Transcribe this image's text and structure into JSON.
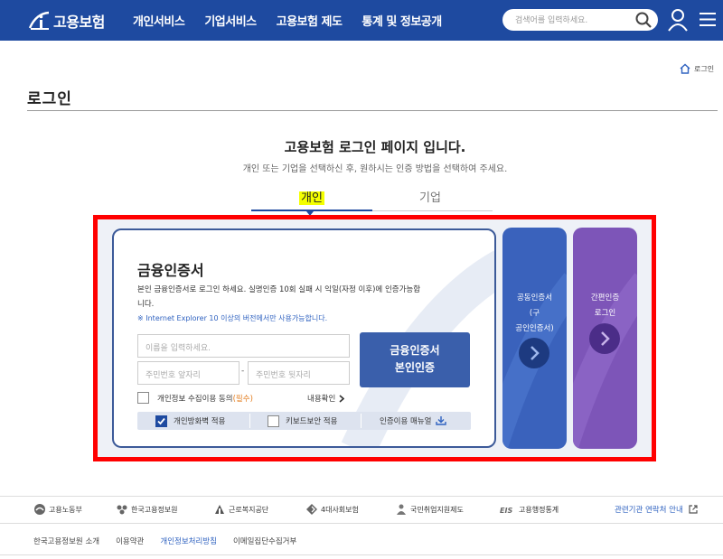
{
  "header": {
    "logo_text": "고용보험",
    "nav": [
      "개인서비스",
      "기업서비스",
      "고용보험 제도",
      "통계 및 정보공개"
    ],
    "search_placeholder": "검색어를 입력하세요.",
    "icons": {
      "search": "search-icon",
      "user": "user-icon",
      "menu": "hamburger-menu-icon"
    },
    "color": "#1e4aa0"
  },
  "breadcrumb": {
    "home_label": "로그인"
  },
  "page": {
    "title": "로그인",
    "heading": "고용보험 로그인 페이지 입니다.",
    "subheading": "개인 또는 기업을 선택하신 후, 원하시는 인증 방법을 선택하여 주세요."
  },
  "tabs": [
    {
      "label": "개인",
      "active": true
    },
    {
      "label": "기업",
      "active": false
    }
  ],
  "financial_cert": {
    "title": "금융인증서",
    "desc": "본인 금융인증서로 로그인 하세요. 실명인증 10회 실패 시 익일(자정 이후)에 인증가능합니다.",
    "note": "※ Internet Explorer 10 이상의 버전에서만 사용가능합니다.",
    "name_placeholder": "이름을 입력하세요.",
    "rrn_front_placeholder": "주민번호 앞자리",
    "rrn_dash": "-",
    "rrn_back_placeholder": "주민번호 뒷자리",
    "login_button_line1": "금융인증서",
    "login_button_line2": "본인인증",
    "consent_label": "개인정보 수집이용 동의",
    "consent_required": "(필수)",
    "consent_view": "내용확인",
    "options": {
      "firewall": "개인방화벽 적용",
      "firewall_checked": true,
      "keyboard": "키보드보안 적용",
      "keyboard_checked": false,
      "manual": "인증이용 매뉴얼"
    }
  },
  "side_cards": {
    "joint_cert_lines": [
      "공동인증서",
      "(구",
      "공인인증서)"
    ],
    "simple_cert_lines": [
      "간편인증",
      "로그인"
    ]
  },
  "footer": {
    "orgs": [
      "고용노동부",
      "한국고용정보원",
      "근로복지공단",
      "4대사회보험",
      "국민취업지원제도",
      "고용행정통계"
    ],
    "contact": "관련기관 연락처 안내",
    "links": [
      "한국고용정보원 소개",
      "이용약관",
      "개인정보처리방침",
      "이메일집단수집거부"
    ]
  },
  "colors": {
    "accent": "#1e4aa0",
    "highlight_frame": "#ff0000",
    "simple_card": "#7d55b8",
    "joint_card": "#3a62bc"
  }
}
